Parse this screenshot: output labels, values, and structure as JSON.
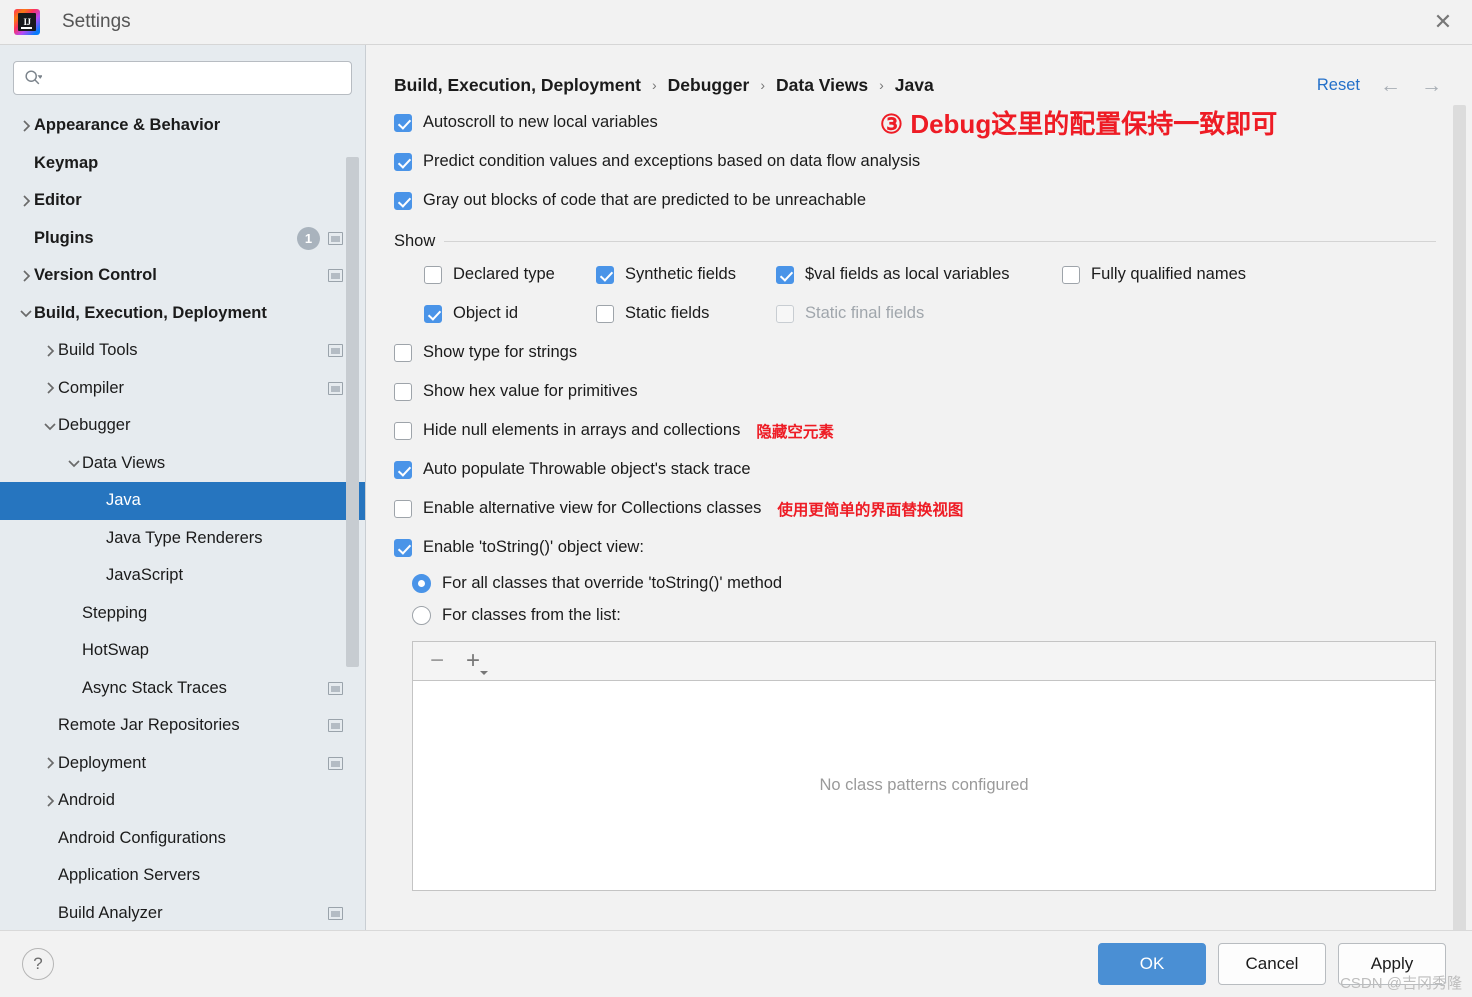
{
  "window": {
    "title": "Settings",
    "logo_text": "IJ",
    "close_icon": "close-icon"
  },
  "sidebar": {
    "search": {
      "value": "",
      "placeholder": ""
    },
    "items": [
      {
        "label": "Appearance & Behavior",
        "indent": 0,
        "chevron": "right",
        "bold": true,
        "badge": "",
        "win_icon": false,
        "selected": false
      },
      {
        "label": "Keymap",
        "indent": 0,
        "chevron": "none",
        "bold": true,
        "badge": "",
        "win_icon": false,
        "selected": false
      },
      {
        "label": "Editor",
        "indent": 0,
        "chevron": "right",
        "bold": true,
        "badge": "",
        "win_icon": false,
        "selected": false
      },
      {
        "label": "Plugins",
        "indent": 0,
        "chevron": "none",
        "bold": true,
        "badge": "1",
        "win_icon": true,
        "selected": false
      },
      {
        "label": "Version Control",
        "indent": 0,
        "chevron": "right",
        "bold": true,
        "badge": "",
        "win_icon": true,
        "selected": false
      },
      {
        "label": "Build, Execution, Deployment",
        "indent": 0,
        "chevron": "down",
        "bold": true,
        "badge": "",
        "win_icon": false,
        "selected": false
      },
      {
        "label": "Build Tools",
        "indent": 1,
        "chevron": "right",
        "bold": false,
        "badge": "",
        "win_icon": true,
        "selected": false
      },
      {
        "label": "Compiler",
        "indent": 1,
        "chevron": "right",
        "bold": false,
        "badge": "",
        "win_icon": true,
        "selected": false
      },
      {
        "label": "Debugger",
        "indent": 1,
        "chevron": "down",
        "bold": false,
        "badge": "",
        "win_icon": false,
        "selected": false
      },
      {
        "label": "Data Views",
        "indent": 2,
        "chevron": "down",
        "bold": false,
        "badge": "",
        "win_icon": false,
        "selected": false
      },
      {
        "label": "Java",
        "indent": 3,
        "chevron": "none",
        "bold": false,
        "badge": "",
        "win_icon": false,
        "selected": true
      },
      {
        "label": "Java Type Renderers",
        "indent": 3,
        "chevron": "none",
        "bold": false,
        "badge": "",
        "win_icon": false,
        "selected": false
      },
      {
        "label": "JavaScript",
        "indent": 3,
        "chevron": "none",
        "bold": false,
        "badge": "",
        "win_icon": false,
        "selected": false
      },
      {
        "label": "Stepping",
        "indent": 2,
        "chevron": "none",
        "bold": false,
        "badge": "",
        "win_icon": false,
        "selected": false
      },
      {
        "label": "HotSwap",
        "indent": 2,
        "chevron": "none",
        "bold": false,
        "badge": "",
        "win_icon": false,
        "selected": false
      },
      {
        "label": "Async Stack Traces",
        "indent": 2,
        "chevron": "none",
        "bold": false,
        "badge": "",
        "win_icon": true,
        "selected": false
      },
      {
        "label": "Remote Jar Repositories",
        "indent": 1,
        "chevron": "none",
        "bold": false,
        "badge": "",
        "win_icon": true,
        "selected": false
      },
      {
        "label": "Deployment",
        "indent": 1,
        "chevron": "right",
        "bold": false,
        "badge": "",
        "win_icon": true,
        "selected": false
      },
      {
        "label": "Android",
        "indent": 1,
        "chevron": "right",
        "bold": false,
        "badge": "",
        "win_icon": false,
        "selected": false
      },
      {
        "label": "Android Configurations",
        "indent": 1,
        "chevron": "none",
        "bold": false,
        "badge": "",
        "win_icon": false,
        "selected": false
      },
      {
        "label": "Application Servers",
        "indent": 1,
        "chevron": "none",
        "bold": false,
        "badge": "",
        "win_icon": false,
        "selected": false
      },
      {
        "label": "Build Analyzer",
        "indent": 1,
        "chevron": "none",
        "bold": false,
        "badge": "",
        "win_icon": true,
        "selected": false
      }
    ]
  },
  "main": {
    "breadcrumb": [
      "Build, Execution, Deployment",
      "Debugger",
      "Data Views",
      "Java"
    ],
    "breadcrumb_separator": "›",
    "reset_label": "Reset",
    "nav_back_icon": "arrow-left-icon",
    "nav_forward_icon": "arrow-right-icon",
    "top_options": [
      {
        "label": "Autoscroll to new local variables",
        "checked": true,
        "note": ""
      },
      {
        "label": "Predict condition values and exceptions based on data flow analysis",
        "checked": true,
        "note": ""
      },
      {
        "label": "Gray out blocks of code that are predicted to be unreachable",
        "checked": true,
        "note": ""
      }
    ],
    "annotation_top": "③ Debug这里的配置保持一致即可",
    "show_group": {
      "title": "Show",
      "row1": [
        {
          "label": "Declared type",
          "checked": false,
          "disabled": false
        },
        {
          "label": "Synthetic fields",
          "checked": true,
          "disabled": false
        },
        {
          "label": "$val fields as local variables",
          "checked": true,
          "disabled": false
        },
        {
          "label": "Fully qualified names",
          "checked": false,
          "disabled": false
        }
      ],
      "row2": [
        {
          "label": "Object id",
          "checked": true,
          "disabled": false
        },
        {
          "label": "Static fields",
          "checked": false,
          "disabled": false
        },
        {
          "label": "Static final fields",
          "checked": false,
          "disabled": true
        }
      ]
    },
    "mid_options": [
      {
        "label": "Show type for strings",
        "checked": false,
        "note": ""
      },
      {
        "label": "Show hex value for primitives",
        "checked": false,
        "note": ""
      },
      {
        "label": "Hide null elements in arrays and collections",
        "checked": false,
        "note": "隐藏空元素"
      },
      {
        "label": "Auto populate Throwable object's stack trace",
        "checked": true,
        "note": ""
      },
      {
        "label": "Enable alternative view for Collections classes",
        "checked": false,
        "note": "使用更简单的界面替换视图"
      }
    ],
    "tostring": {
      "label": "Enable 'toString()' object view:",
      "checked": true,
      "radios": [
        {
          "label": "For all classes that override 'toString()' method",
          "selected": true
        },
        {
          "label": "For classes from the list:",
          "selected": false
        }
      ]
    },
    "list_panel": {
      "remove_icon": "minus-icon",
      "add_icon": "plus-icon",
      "empty_text": "No class patterns configured"
    }
  },
  "footer": {
    "help_label": "?",
    "buttons": [
      {
        "label": "OK",
        "primary": true
      },
      {
        "label": "Cancel",
        "primary": false
      },
      {
        "label": "Apply",
        "primary": false
      }
    ],
    "watermark": "CSDN @吉冈秀隆"
  },
  "colors": {
    "accent": "#4a94e8",
    "selection": "#2675bf",
    "link": "#2470c9",
    "annotation_red": "#ee1c25",
    "sidebar_bg": "#e6ebef",
    "main_bg": "#f2f2f2"
  }
}
